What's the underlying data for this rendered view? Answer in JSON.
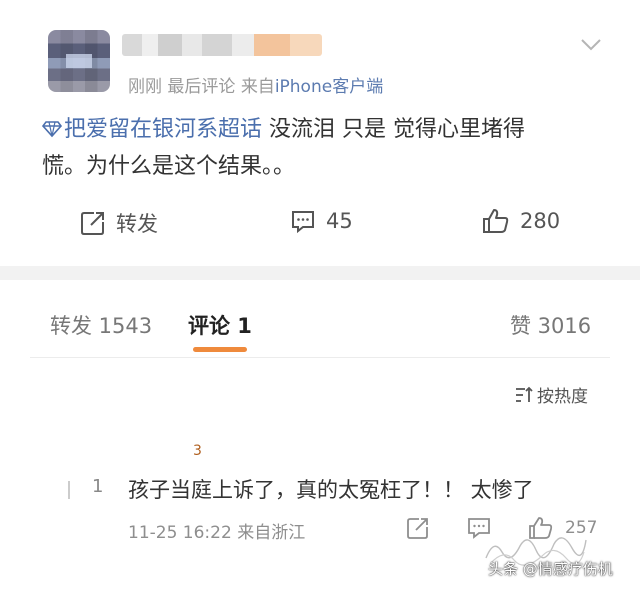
{
  "post": {
    "time": "刚刚",
    "edit_note": "最后评论",
    "source_prefix": "来自",
    "source": "iPhone客户端",
    "topic": "把爱留在银河系超话",
    "line1_text": " 没流泪 只是 觉得心里堵得",
    "line2_text": "慌。为什么是这个结果。。"
  },
  "actions": {
    "repost_label": "转发",
    "comment_count": "45",
    "like_count": "280"
  },
  "tabs": {
    "repost": "转发 1543",
    "comment": "评论 1",
    "like": "赞 3016"
  },
  "sort": {
    "label": "按热度"
  },
  "comment": {
    "mark": "3",
    "floor": "1",
    "text": "孩子当庭上诉了，真的太冤枉了！！ 太惨了",
    "time": "11-25 16:22",
    "location": "来自浙江",
    "likes": "257"
  },
  "watermark": {
    "text": "头条 @情感疗伤机"
  },
  "colors": {
    "link": "#4b6fad",
    "source": "#5c7bb0",
    "tab_underline": "#ef8a3c",
    "separator": "#f2f2f2"
  },
  "icons": [
    "chevron-down-icon",
    "super-topic-icon",
    "repost-icon",
    "comment-icon",
    "like-icon",
    "sort-icon",
    "share-icon"
  ]
}
